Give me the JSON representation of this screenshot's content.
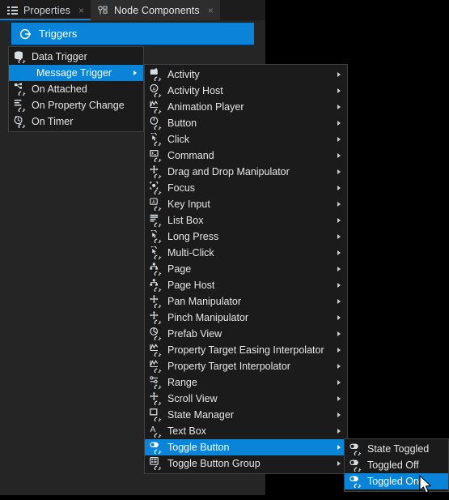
{
  "window": {
    "background_color": "#000000",
    "panel_color": "#252526",
    "accent_color": "#0a84d8"
  },
  "tabs": [
    {
      "label": "Properties",
      "icon": "list-icon",
      "close": "×",
      "active": false
    },
    {
      "label": "Node Components",
      "icon": "node-components-icon",
      "close": "×",
      "active": true
    }
  ],
  "header": {
    "title": "Triggers",
    "icon": "trigger-icon"
  },
  "menus": {
    "trigger_menu": {
      "items": [
        {
          "label": "Data Trigger",
          "icon": "data-trigger-icon",
          "submenu": false,
          "selected": false
        },
        {
          "label": "Message Trigger",
          "icon": "",
          "submenu": true,
          "selected": true
        },
        {
          "label": "On Attached",
          "icon": "on-attached-icon",
          "submenu": false,
          "selected": false
        },
        {
          "label": "On Property Change",
          "icon": "on-property-change-icon",
          "submenu": false,
          "selected": false
        },
        {
          "label": "On Timer",
          "icon": "on-timer-icon",
          "submenu": false,
          "selected": false
        }
      ]
    },
    "message_trigger_menu": {
      "items": [
        {
          "label": "Activity",
          "icon": "activity-icon",
          "submenu": true,
          "selected": false
        },
        {
          "label": "Activity Host",
          "icon": "activity-host-icon",
          "submenu": true,
          "selected": false
        },
        {
          "label": "Animation Player",
          "icon": "animation-player-icon",
          "submenu": true,
          "selected": false
        },
        {
          "label": "Button",
          "icon": "button-icon",
          "submenu": true,
          "selected": false
        },
        {
          "label": "Click",
          "icon": "click-icon",
          "submenu": true,
          "selected": false
        },
        {
          "label": "Command",
          "icon": "command-icon",
          "submenu": true,
          "selected": false
        },
        {
          "label": "Drag and Drop Manipulator",
          "icon": "manipulator-icon",
          "submenu": true,
          "selected": false
        },
        {
          "label": "Focus",
          "icon": "focus-icon",
          "submenu": true,
          "selected": false
        },
        {
          "label": "Key Input",
          "icon": "key-input-icon",
          "submenu": true,
          "selected": false
        },
        {
          "label": "List Box",
          "icon": "list-box-icon",
          "submenu": true,
          "selected": false
        },
        {
          "label": "Long Press",
          "icon": "click-icon",
          "submenu": true,
          "selected": false
        },
        {
          "label": "Multi-Click",
          "icon": "click-icon",
          "submenu": true,
          "selected": false
        },
        {
          "label": "Page",
          "icon": "page-icon",
          "submenu": true,
          "selected": false
        },
        {
          "label": "Page Host",
          "icon": "page-icon",
          "submenu": true,
          "selected": false
        },
        {
          "label": "Pan Manipulator",
          "icon": "manipulator-icon",
          "submenu": true,
          "selected": false
        },
        {
          "label": "Pinch Manipulator",
          "icon": "manipulator-icon",
          "submenu": true,
          "selected": false
        },
        {
          "label": "Prefab View",
          "icon": "prefab-view-icon",
          "submenu": true,
          "selected": false
        },
        {
          "label": "Property Target Easing Interpolator",
          "icon": "animation-player-icon",
          "submenu": true,
          "selected": false
        },
        {
          "label": "Property Target Interpolator",
          "icon": "animation-player-icon",
          "submenu": true,
          "selected": false
        },
        {
          "label": "Range",
          "icon": "range-icon",
          "submenu": true,
          "selected": false
        },
        {
          "label": "Scroll View",
          "icon": "manipulator-icon",
          "submenu": true,
          "selected": false
        },
        {
          "label": "State Manager",
          "icon": "state-manager-icon",
          "submenu": true,
          "selected": false
        },
        {
          "label": "Text Box",
          "icon": "text-box-icon",
          "submenu": true,
          "selected": false
        },
        {
          "label": "Toggle Button",
          "icon": "toggle-button-icon",
          "submenu": true,
          "selected": true
        },
        {
          "label": "Toggle Button Group",
          "icon": "toggle-button-group-icon",
          "submenu": true,
          "selected": false
        }
      ]
    },
    "toggle_button_menu": {
      "items": [
        {
          "label": "State Toggled",
          "icon": "toggle-button-icon",
          "submenu": false,
          "selected": false
        },
        {
          "label": "Toggled Off",
          "icon": "toggle-button-icon",
          "submenu": false,
          "selected": false
        },
        {
          "label": "Toggled On",
          "icon": "toggle-button-icon",
          "submenu": false,
          "selected": true
        }
      ]
    }
  },
  "cursor": {
    "type": "arrow-pointer"
  }
}
